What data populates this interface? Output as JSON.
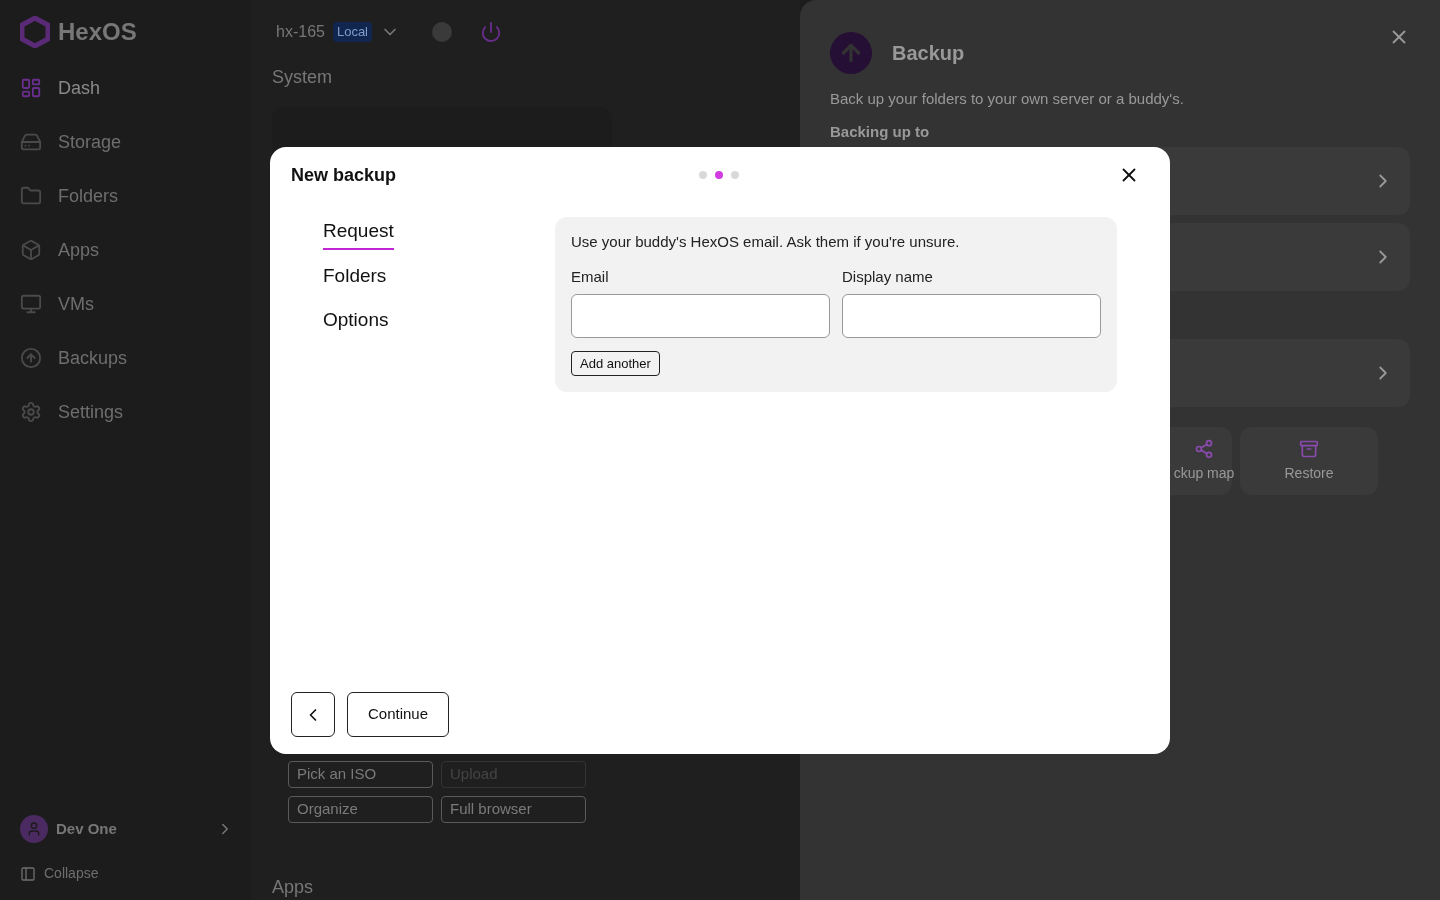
{
  "sidebar": {
    "logo": "HexOS",
    "items": [
      {
        "label": "Dash",
        "selected": true
      },
      {
        "label": "Storage",
        "selected": false
      },
      {
        "label": "Folders",
        "selected": false
      },
      {
        "label": "Apps",
        "selected": false
      },
      {
        "label": "VMs",
        "selected": false
      },
      {
        "label": "Backups",
        "selected": false
      },
      {
        "label": "Settings",
        "selected": false
      }
    ],
    "user": "Dev One",
    "collapse": "Collapse"
  },
  "header": {
    "server": "hx-165",
    "badge": "Local"
  },
  "main": {
    "section": "System",
    "buttons": [
      {
        "label": "Pick an ISO",
        "disabled": false
      },
      {
        "label": "Upload",
        "disabled": true
      },
      {
        "label": "Organize",
        "disabled": false
      },
      {
        "label": "Full browser",
        "disabled": false
      }
    ],
    "next_section": "Apps"
  },
  "panel": {
    "title": "Backup",
    "description": "Back up your folders to your own server or a buddy's.",
    "subtitle": "Backing up to",
    "tiles": [
      "ckup map",
      "Restore"
    ]
  },
  "dialog": {
    "title": "New backup",
    "steps_dots": [
      {
        "selected": false
      },
      {
        "selected": true
      },
      {
        "selected": false
      }
    ],
    "steps": [
      {
        "label": "Request",
        "selected": true
      },
      {
        "label": "Folders",
        "selected": false
      },
      {
        "label": "Options",
        "selected": false
      }
    ],
    "hint": "Use your buddy's HexOS email. Ask them if you're unsure.",
    "fields": [
      {
        "label": "Email"
      },
      {
        "label": "Display name"
      }
    ],
    "add_button": "Add another",
    "continue_button": "Continue"
  }
}
